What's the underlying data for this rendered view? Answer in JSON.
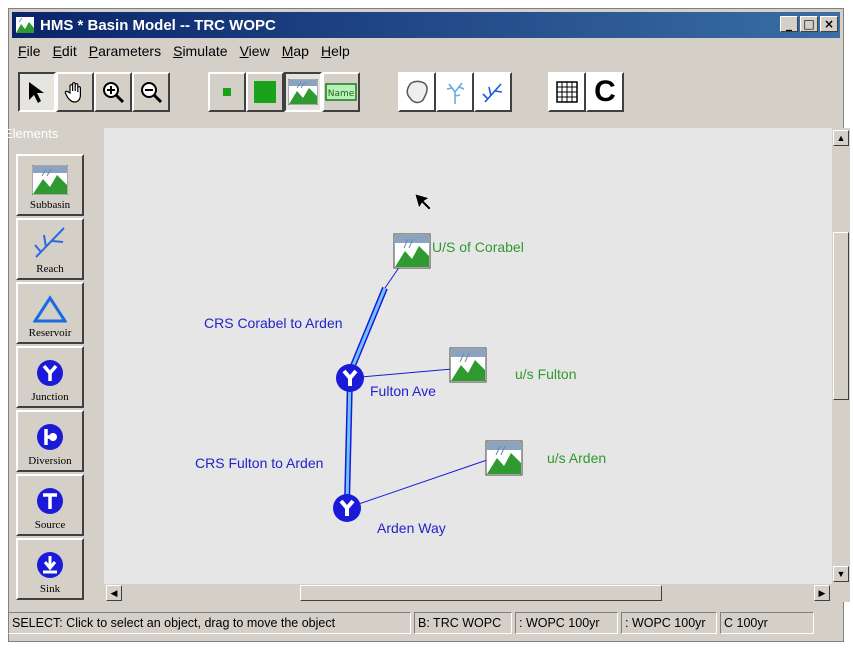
{
  "window": {
    "title": "HMS * Basin Model -- TRC WOPC",
    "buttons": {
      "minimize": "_",
      "maximize": "□",
      "close": "×"
    }
  },
  "menu": [
    {
      "label": "File"
    },
    {
      "label": "Edit"
    },
    {
      "label": "Parameters"
    },
    {
      "label": "Simulate"
    },
    {
      "label": "View"
    },
    {
      "label": "Map"
    },
    {
      "label": "Help"
    }
  ],
  "toolbar": {
    "tools": [
      "select-arrow-icon",
      "hand-pan-icon",
      "zoom-in-icon",
      "zoom-out-icon"
    ],
    "element_size": [
      "small-square-icon",
      "large-square-icon",
      "subbasin-icon",
      "name-label-icon"
    ],
    "name_icon_text": "Name",
    "map_layers": [
      "boundary-icon",
      "stream-network-icon",
      "reach-icon"
    ],
    "grid_icon": "grid-icon",
    "c_label": "C"
  },
  "palette": {
    "title": "Elements",
    "items": [
      {
        "label": "Subbasin",
        "icon": "subbasin-icon"
      },
      {
        "label": "Reach",
        "icon": "reach-icon"
      },
      {
        "label": "Reservoir",
        "icon": "reservoir-icon"
      },
      {
        "label": "Junction",
        "icon": "junction-icon"
      },
      {
        "label": "Diversion",
        "icon": "diversion-icon"
      },
      {
        "label": "Source",
        "icon": "source-icon"
      },
      {
        "label": "Sink",
        "icon": "sink-icon"
      }
    ]
  },
  "model": {
    "subbasins": [
      {
        "name": "U/S of Corabel"
      },
      {
        "name": "u/s Fulton"
      },
      {
        "name": "u/s Arden"
      }
    ],
    "junctions": [
      {
        "name": "Fulton Ave"
      },
      {
        "name": "Arden Way"
      }
    ],
    "reaches": [
      {
        "name": "CRS Corabel to Arden"
      },
      {
        "name": "CRS Fulton to Arden"
      }
    ]
  },
  "status": {
    "message": "SELECT: Click to select an object, drag to move the object",
    "basin": "B: TRC WOPC",
    "met": ": WOPC 100yr",
    "control": ": WOPC 100yr",
    "run": "C 100yr"
  },
  "colors": {
    "titlebar": "#0a246a",
    "window_bg": "#d4d0c8",
    "canvas_bg": "#e6e6e6",
    "element_blue": "#2222cc",
    "subbasin_green": "#2f9a2f",
    "reach_blue": "#4fa8ff"
  }
}
